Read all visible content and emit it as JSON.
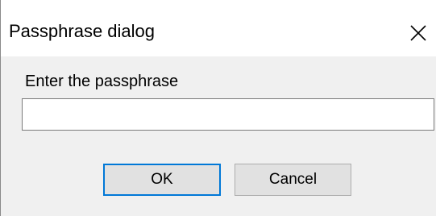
{
  "window": {
    "title": "Passphrase dialog",
    "close_icon": "close-icon"
  },
  "dialog": {
    "prompt": "Enter the passphrase",
    "passphrase_value": "",
    "ok_label": "OK",
    "cancel_label": "Cancel"
  },
  "colors": {
    "accent": "#0078d7",
    "button_face": "#e1e1e1",
    "client_background": "#f0f0f0",
    "titlebar_background": "#ffffff"
  }
}
